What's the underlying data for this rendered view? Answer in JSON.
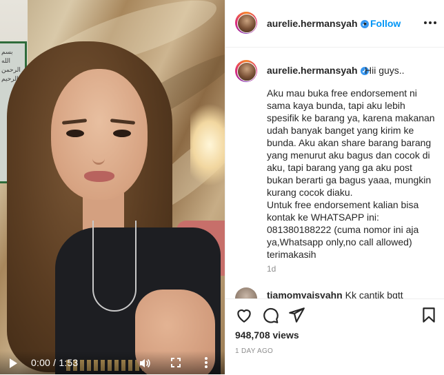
{
  "video": {
    "time_label": "0:00 / 1:53",
    "frame_calligraphy": "بسم الله\nالرحمن\nالرحيم"
  },
  "header": {
    "username": "aurelie.hermansyah",
    "verified_icon": "verified-badge-icon",
    "separator": "•",
    "follow_label": "Follow",
    "more_icon": "more-options-icon"
  },
  "post": {
    "username": "aurelie.hermansyah",
    "caption_first": "Hii guys..",
    "caption_body": "Aku mau buka free endorsement ni sama kaya bunda, tapi aku lebih spesifik ke barang ya, karena makanan udah banyak banget yang kirim ke bunda. Aku akan share barang barang yang menurut aku bagus dan cocok di aku, tapi barang yang ga aku post bukan berarti ga bagus yaaa, mungkin kurang cocok diaku.\nUntuk free endorsement kalian bisa kontak ke WHATSAPP ini:\n081380188222 (cuma nomor ini aja ya,Whatsapp only,no call allowed)\nterimakasih",
    "age": "1d"
  },
  "reply": {
    "username": "tiamomyaisyahn",
    "text": "Kk cantik bgtt"
  },
  "actions": {
    "views": "948,708 views",
    "posted": "1 DAY AGO"
  },
  "colors": {
    "link": "#0095f6",
    "verified": "#3897f0",
    "muted": "#8e8e8e"
  }
}
